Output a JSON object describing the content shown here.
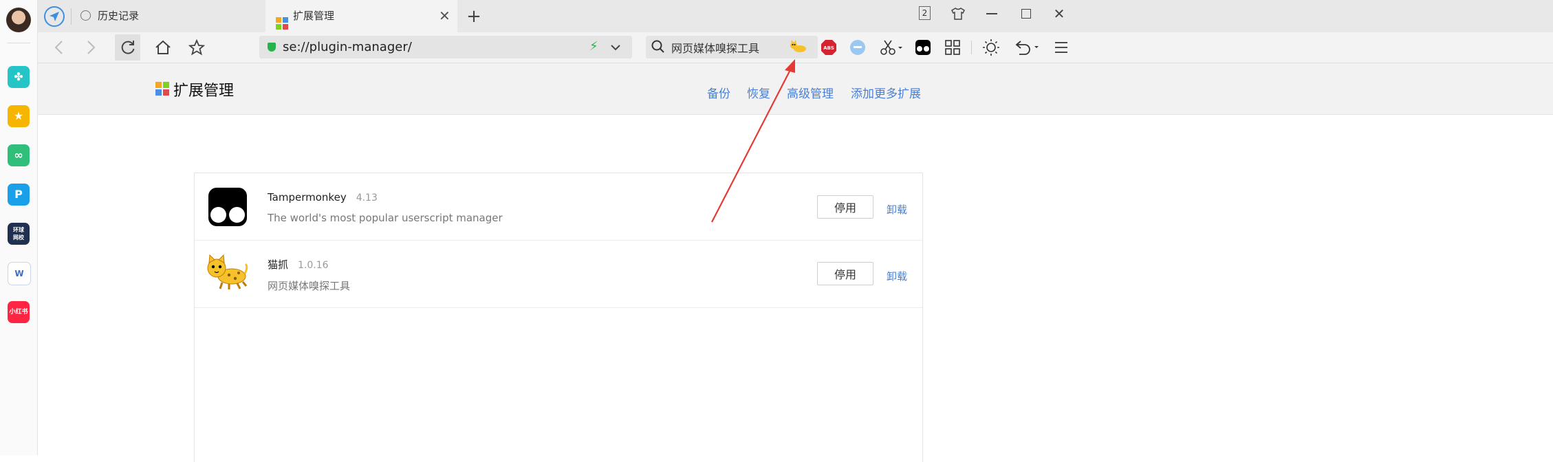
{
  "tabs": [
    {
      "label": "历史记录",
      "icon": "clock-icon",
      "active": false
    },
    {
      "label": "扩展管理",
      "icon": "puzzle-grid-icon",
      "active": true
    }
  ],
  "window": {
    "badge_count": "2"
  },
  "address_bar": {
    "url": "se://plugin-manager/"
  },
  "search_bar": {
    "value": "网页媒体嗅探工具"
  },
  "page": {
    "title": "扩展管理",
    "header_links": [
      "备份",
      "恢复",
      "高级管理",
      "添加更多扩展"
    ]
  },
  "extensions": [
    {
      "name": "Tampermonkey",
      "version": "4.13",
      "description": "The world's most popular userscript manager",
      "disable_label": "停用",
      "uninstall_label": "卸载"
    },
    {
      "name": "猫抓",
      "version": "1.0.16",
      "description": "网页媒体嗅探工具",
      "disable_label": "停用",
      "uninstall_label": "卸载"
    }
  ],
  "sidebar": {
    "items": [
      "avatar",
      "clover-app-icon",
      "star-app-icon",
      "cloud-app-icon",
      "p-app-icon",
      "hq-school-app-icon",
      "word-doc-icon",
      "xiaohongshu-app-icon"
    ],
    "labels": {
      "hq": "环球\n网校",
      "xhs": "小红书"
    }
  },
  "colors": {
    "accent": "#4a7fd4",
    "annotation_arrow": "#e53935"
  }
}
